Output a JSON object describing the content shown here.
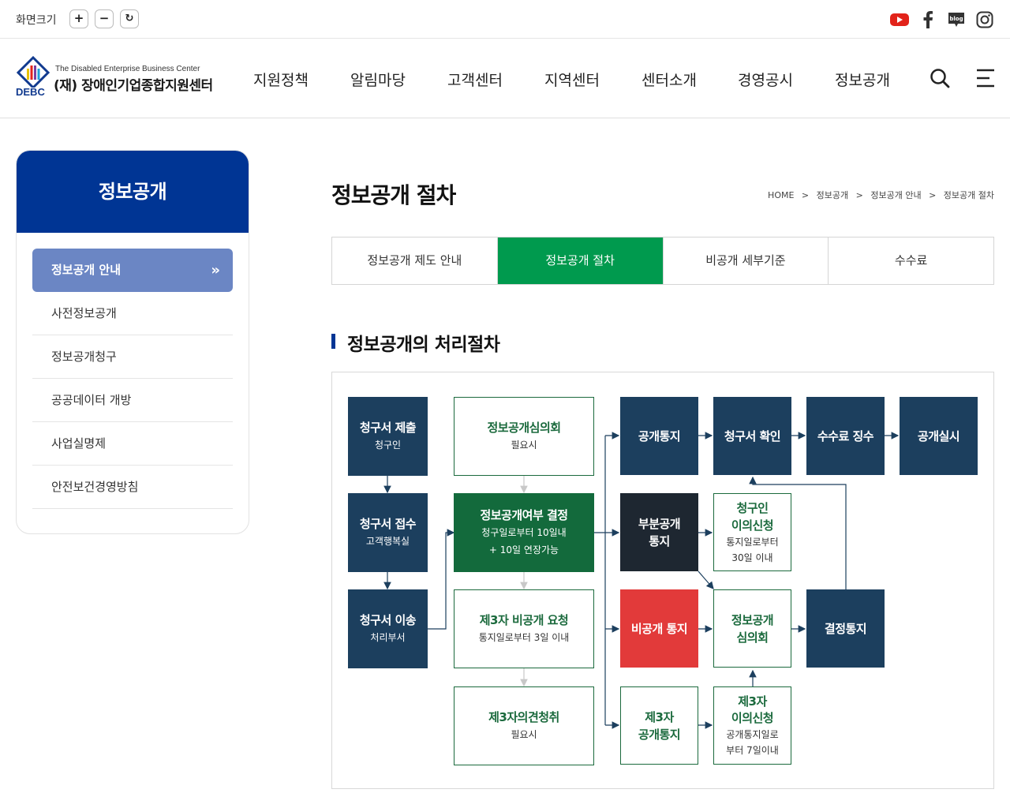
{
  "util": {
    "label": "화면크기",
    "zoom_in": "+",
    "zoom_out": "−",
    "reset": "↻",
    "icons": [
      "youtube-icon",
      "facebook-icon",
      "blog-icon",
      "instagram-icon"
    ],
    "blog_text": "blog"
  },
  "logo": {
    "en": "The Disabled Enterprise Business Center",
    "ko": "(재) 장애인기업종합지원센터",
    "abbr": "DEBC"
  },
  "gnb": [
    "지원정책",
    "알림마당",
    "고객센터",
    "지역센터",
    "센터소개",
    "경영공시",
    "정보공개"
  ],
  "sidebar": {
    "title": "정보공개",
    "active": "정보공개 안내",
    "items": [
      "사전정보공개",
      "정보공개청구",
      "공공데이터 개방",
      "사업실명제",
      "안전보건경영방침"
    ]
  },
  "page": {
    "title": "정보공개 절차",
    "breadcrumb": [
      "HOME",
      "정보공개",
      "정보공개 안내",
      "정보공개 절차"
    ],
    "breadcrumb_sep": ">",
    "tabs": [
      "정보공개 제도 안내",
      "정보공개 절차",
      "비공개 세부기준",
      "수수료"
    ],
    "active_tab": 1,
    "section_title": "정보공개의 처리절차"
  },
  "flow": {
    "submit": {
      "t1": "청구서 제출",
      "t2": "청구인"
    },
    "receive": {
      "t1": "청구서 접수",
      "t2": "고객행복실"
    },
    "transfer": {
      "t1": "청구서 이송",
      "t2": "처리부서"
    },
    "committee": {
      "t1": "정보공개심의회",
      "t2": "필요시"
    },
    "decision": {
      "t1": "정보공개여부 결정",
      "t2a": "청구일로부터 10일내",
      "t2b": "+ 10일 연장가능"
    },
    "third_request": {
      "t1": "제3자 비공개 요청",
      "t2": "통지일로부터 3일 이내"
    },
    "third_opinion": {
      "t1": "제3자의견청취",
      "t2": "필요시"
    },
    "notify_open": {
      "t1": "공개통지"
    },
    "confirm": {
      "t1": "청구서 확인"
    },
    "fee": {
      "t1": "수수료 징수"
    },
    "execute": {
      "t1": "공개실시"
    },
    "partial": {
      "t1a": "부분공개",
      "t1b": "통지"
    },
    "objection": {
      "t1a": "청구인",
      "t1b": "이의신청",
      "t2a": "통지일로부터",
      "t2b": "30일 이내"
    },
    "nondisclose": {
      "t1": "비공개 통지"
    },
    "review": {
      "t1a": "정보공개",
      "t1b": "심의회"
    },
    "result": {
      "t1": "결정통지"
    },
    "third_notify": {
      "t1a": "제3자",
      "t1b": "공개통지"
    },
    "third_objection": {
      "t1a": "제3자",
      "t1b": "이의신청",
      "t2a": "공개통지일로",
      "t2b": "부터 7일이내"
    }
  },
  "colors": {
    "brand_blue": "#003594",
    "tab_green": "#009a4e",
    "navy_box": "#1c3f5e",
    "green_box": "#136a3c",
    "dark_box": "#1e2731",
    "red_box": "#e23a3a"
  }
}
